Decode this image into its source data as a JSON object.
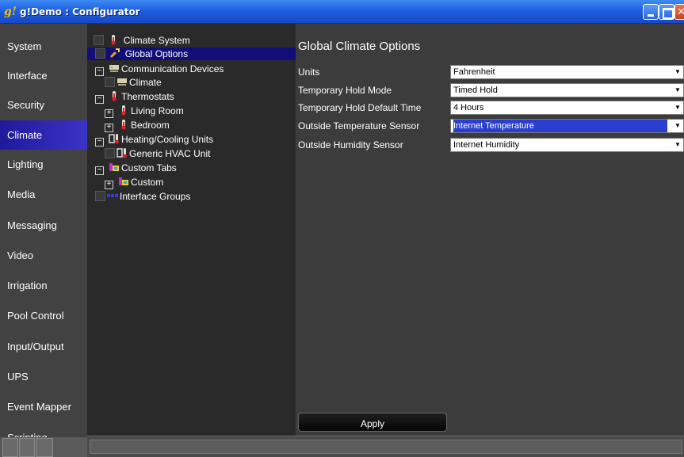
{
  "window": {
    "icon_glyph": "g!",
    "title": "g!Demo : Configurator"
  },
  "sidebar": {
    "items": [
      {
        "label": "System"
      },
      {
        "label": "Interface"
      },
      {
        "label": "Security"
      },
      {
        "label": "Climate",
        "active": true
      },
      {
        "label": "Lighting"
      },
      {
        "label": "Media"
      },
      {
        "label": "Messaging"
      },
      {
        "label": "Video"
      },
      {
        "label": "Irrigation"
      },
      {
        "label": "Pool Control"
      },
      {
        "label": "Input/Output"
      },
      {
        "label": "UPS"
      },
      {
        "label": "Event Mapper"
      },
      {
        "label": "Scripting"
      }
    ]
  },
  "tree": {
    "items": [
      {
        "label": "Climate System",
        "icon": "thermometer-icon"
      },
      {
        "label": "Global Options",
        "icon": "wrench-icon",
        "selected": true
      },
      {
        "label": "Communication Devices",
        "icon": "network-device-icon",
        "expander": "−"
      },
      {
        "label": "Climate",
        "icon": "network-device-icon"
      },
      {
        "label": "Thermostats",
        "icon": "thermometer-icon",
        "expander": "−"
      },
      {
        "label": "Living Room",
        "icon": "thermometer-icon",
        "expander": "+"
      },
      {
        "label": "Bedroom",
        "icon": "thermometer-icon",
        "expander": "+"
      },
      {
        "label": "Heating/Cooling Units",
        "icon": "hvac-icon",
        "expander": "−"
      },
      {
        "label": "Generic HVAC Unit",
        "icon": "hvac-icon"
      },
      {
        "label": "Custom Tabs",
        "icon": "tabs-icon",
        "expander": "−"
      },
      {
        "label": "Custom",
        "icon": "tabs-icon",
        "expander": "+"
      },
      {
        "label": "Interface Groups",
        "icon": "groups-icon"
      }
    ]
  },
  "main": {
    "title": "Global Climate Options",
    "options": [
      {
        "label": "Units",
        "value": "Fahrenheit"
      },
      {
        "label": "Temporary Hold Mode",
        "value": "Timed Hold"
      },
      {
        "label": "Temporary Hold Default Time",
        "value": "4 Hours"
      },
      {
        "label": "Outside Temperature Sensor",
        "value": "Internet Temperature",
        "highlighted": true
      },
      {
        "label": "Outside Humidity Sensor",
        "value": "Internet Humidity"
      }
    ],
    "apply_label": "Apply"
  },
  "colors": {
    "titlebar": "#1f5fe0",
    "sidebar_bg": "#424242",
    "active_nav": "#2a24b0",
    "tree_bg": "#2a2a2a",
    "content_bg": "#3c3c3c",
    "selection": "#110e7a"
  }
}
